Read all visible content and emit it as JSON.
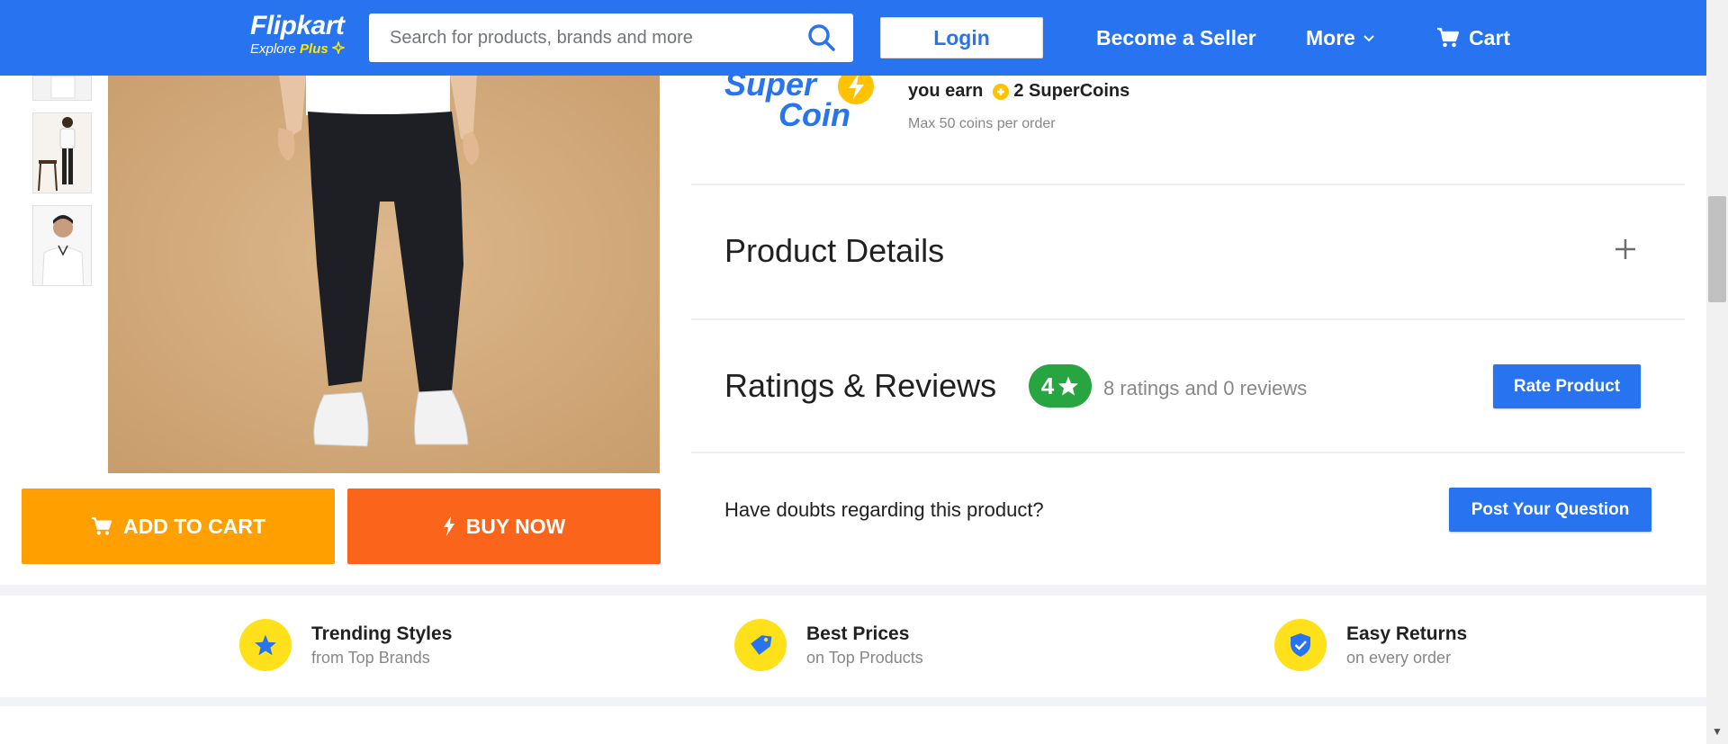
{
  "header": {
    "logo": "Flipkart",
    "logo_tagline_explore": "Explore",
    "logo_tagline_plus": "Plus",
    "search_placeholder": "Search for products, brands and more",
    "login_label": "Login",
    "seller_label": "Become a Seller",
    "more_label": "More",
    "cart_label": "Cart"
  },
  "colors": {
    "brand_blue": "#2874f0",
    "add_to_cart": "#ff9f00",
    "buy_now": "#fb641b",
    "rating_green": "#26a541",
    "feature_yellow": "#ffe11b"
  },
  "gallery": {
    "add_to_cart_label": "ADD TO CART",
    "buy_now_label": "BUY NOW"
  },
  "supercoins": {
    "logo_text_1": "Super",
    "logo_text_2": "Coin",
    "earn_prefix": "you earn",
    "earn_value": "2 SuperCoins",
    "max_text": "Max 50 coins per order"
  },
  "product_details": {
    "title": "Product Details",
    "expand_icon": "plus-icon"
  },
  "ratings": {
    "title": "Ratings & Reviews",
    "average": "4",
    "summary": "8 ratings and 0 reviews",
    "rate_button": "Rate Product"
  },
  "questions": {
    "prompt": "Have doubts regarding this product?",
    "post_button": "Post Your Question"
  },
  "features": [
    {
      "icon": "star-icon",
      "title": "Trending Styles",
      "subtitle": "from Top Brands"
    },
    {
      "icon": "price-tag-icon",
      "title": "Best Prices",
      "subtitle": "on Top Products"
    },
    {
      "icon": "shield-check-icon",
      "title": "Easy Returns",
      "subtitle": "on every order"
    }
  ]
}
